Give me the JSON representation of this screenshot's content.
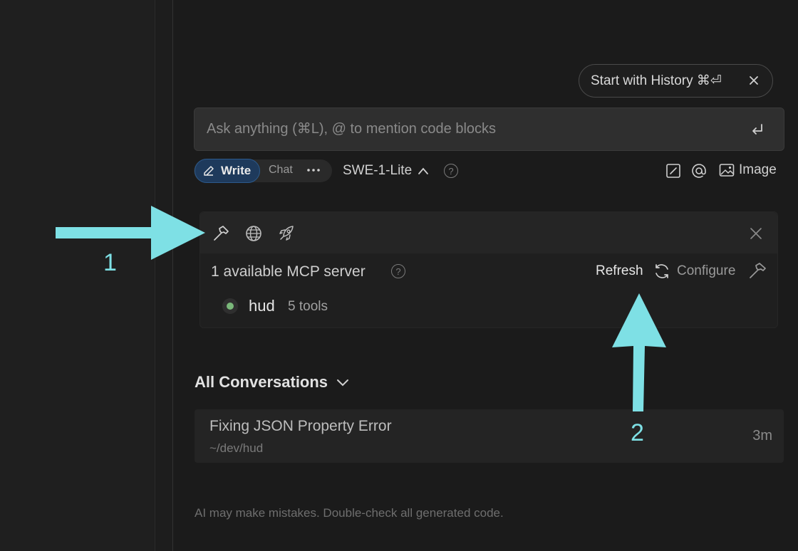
{
  "history_button": {
    "label": "Start with History ⌘⏎"
  },
  "ask_input": {
    "placeholder": "Ask anything (⌘L), @ to mention code blocks",
    "value": ""
  },
  "mode": {
    "write_label": "Write",
    "chat_label": "Chat"
  },
  "model": {
    "label": "SWE-1-Lite"
  },
  "toolbar_right": {
    "image_label": "Image"
  },
  "mcp": {
    "available_label": "1 available MCP server",
    "refresh_label": "Refresh",
    "configure_label": "Configure",
    "servers": [
      {
        "name": "hud",
        "tools": "5 tools",
        "status_color": "#7ab87a"
      }
    ]
  },
  "conversations": {
    "title": "All Conversations",
    "items": [
      {
        "name": "Fixing JSON Property Error",
        "path": "~/dev/hud",
        "time": "3m"
      }
    ]
  },
  "disclaimer": "AI may make mistakes. Double-check all generated code.",
  "annotations": {
    "one": "1",
    "two": "2",
    "color": "#7ee0e5"
  },
  "colors": {
    "accent": "#2c5a8c",
    "background": "#1b1b1b"
  }
}
